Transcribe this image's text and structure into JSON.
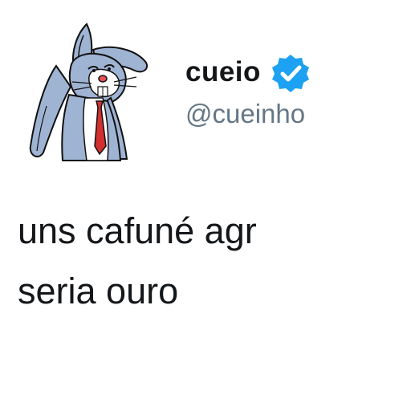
{
  "tweet": {
    "author": {
      "display_name": "cueio",
      "handle": "@cueinho",
      "verified": true,
      "avatar_icon": "bugs-bunny-avatar",
      "badge_icon": "verified-badge-icon",
      "badge_color": "#1da1f2"
    },
    "text_lines": [
      "uns cafuné agr",
      "seria ouro"
    ],
    "colors": {
      "name": "#14171a",
      "handle": "#657786",
      "text": "#14171a"
    }
  }
}
